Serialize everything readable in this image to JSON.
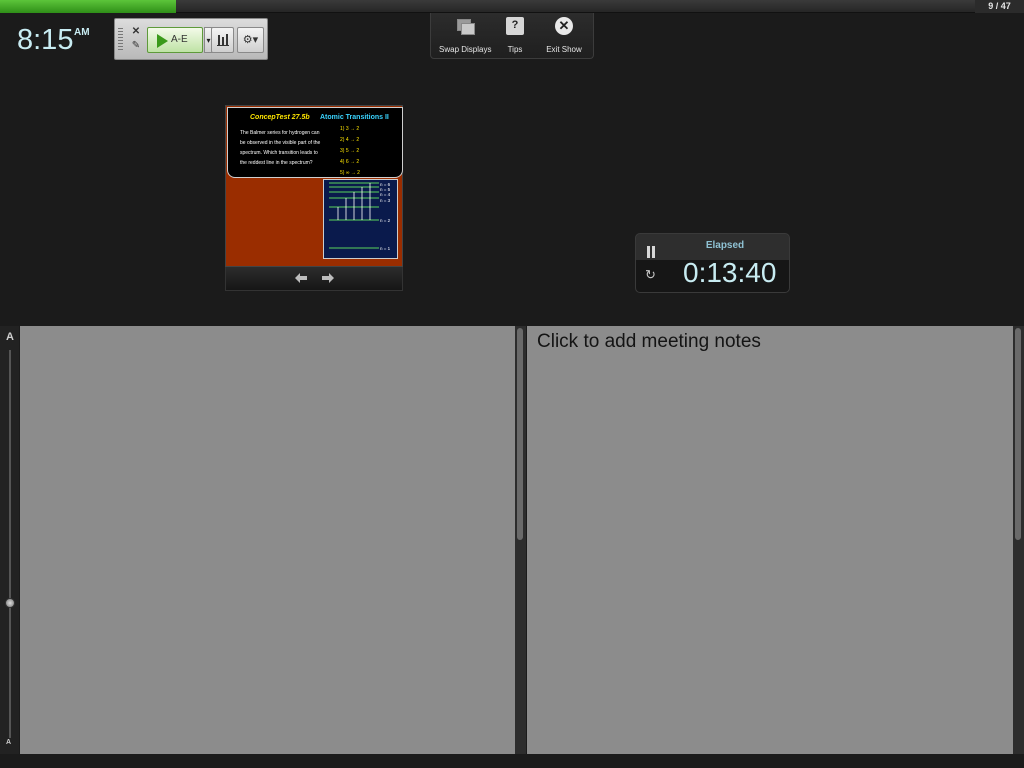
{
  "progress": {
    "current": 9,
    "total": 47,
    "label": "9 / 47",
    "fill_fraction": 0.18,
    "color": "#4caf2a"
  },
  "clock": {
    "time": "8:15",
    "ampm": "AM"
  },
  "response_toolbar": {
    "close_icon": "close-icon",
    "edit_icon": "edit-icon",
    "poll_button_label": "A-E",
    "dropdown_glyph": "▾",
    "chart_icon": "bar-chart-icon",
    "settings_icon": "gear-icon"
  },
  "presenter_menu": {
    "items": [
      {
        "label": "Swap Displays",
        "icon": "swap-displays-icon"
      },
      {
        "label": "Tips",
        "icon": "help-icon",
        "glyph": "?"
      },
      {
        "label": "Exit Show",
        "icon": "close-circle-icon",
        "glyph": "✕"
      }
    ]
  },
  "slide": {
    "title": "ConcepTest 27.5b",
    "subtitle": "Atomic Transitions II",
    "question": "The Balmer series for hydrogen can be observed in the visible part of the spectrum. Which transition leads to the reddest line in the spectrum?",
    "options": [
      "1) 3 → 2",
      "2) 4 → 2",
      "3) 5 → 2",
      "4) 6 → 2",
      "5) ∞ → 2"
    ],
    "diagram_labels": [
      "n = 6",
      "n = 5",
      "n = 4",
      "n = 3",
      "n = 2",
      "n = 1"
    ],
    "background": "#9a2d00"
  },
  "slide_nav": {
    "prev_glyph": "🡄",
    "next_glyph": "🡆"
  },
  "timer": {
    "label": "Elapsed",
    "value": "0:13:40"
  },
  "zoom": {
    "top_label": "A",
    "bottom_label": "A"
  },
  "notes": {
    "placeholder": "Click to add meeting notes"
  }
}
